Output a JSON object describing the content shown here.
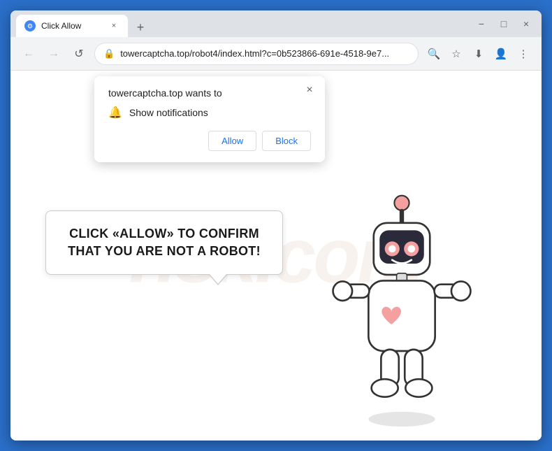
{
  "browser": {
    "title_bar": {
      "tab_title": "Click Allow",
      "close_label": "×",
      "new_tab_label": "+",
      "minimize_label": "−",
      "maximize_label": "□",
      "winclose_label": "×"
    },
    "toolbar": {
      "url": "towercaptcha.top/robot4/index.html?c=0b523866-691e-4518-9e7...",
      "back_icon": "←",
      "forward_icon": "→",
      "refresh_icon": "↺",
      "search_icon": "🔍",
      "bookmark_icon": "☆",
      "profile_icon": "👤",
      "menu_icon": "⋮",
      "download_icon": "⬇"
    }
  },
  "notification_popup": {
    "title": "towercaptcha.top wants to",
    "notification_label": "Show notifications",
    "allow_label": "Allow",
    "block_label": "Block",
    "close_icon": "×"
  },
  "page": {
    "watermark": "risk.com",
    "bubble_text": "CLICK «ALLOW» TO CONFIRM THAT YOU ARE NOT A ROBOT!"
  }
}
